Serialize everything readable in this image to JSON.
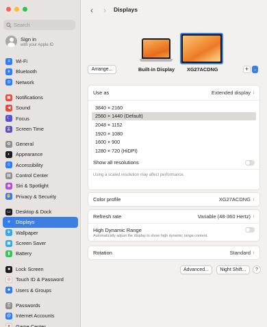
{
  "window": {
    "title": "Displays"
  },
  "sidebar": {
    "search_placeholder": "Search",
    "signin": {
      "title": "Sign in",
      "subtitle": "with your Apple ID"
    },
    "groups": [
      [
        {
          "label": "Wi-Fi",
          "icon": "wifi-icon",
          "color": "#2f7cf6",
          "glyph": "≡"
        },
        {
          "label": "Bluetooth",
          "icon": "bluetooth-icon",
          "color": "#2f7cf6",
          "glyph": "ʙ"
        },
        {
          "label": "Network",
          "icon": "globe-icon",
          "color": "#2f7cf6",
          "glyph": "◎"
        }
      ],
      [
        {
          "label": "Notifications",
          "icon": "bell-icon",
          "color": "#e84a3f",
          "glyph": "▣"
        },
        {
          "label": "Sound",
          "icon": "speaker-icon",
          "color": "#e84a3f",
          "glyph": "◀"
        },
        {
          "label": "Focus",
          "icon": "moon-icon",
          "color": "#5a4fcf",
          "glyph": "☾"
        },
        {
          "label": "Screen Time",
          "icon": "hourglass-icon",
          "color": "#5a4fcf",
          "glyph": "⌛"
        }
      ],
      [
        {
          "label": "General",
          "icon": "gear-icon",
          "color": "#8e8e93",
          "glyph": "⚙"
        },
        {
          "label": "Appearance",
          "icon": "appearance-icon",
          "color": "#1c1c1e",
          "glyph": "◐"
        },
        {
          "label": "Accessibility",
          "icon": "accessibility-icon",
          "color": "#2f7cf6",
          "glyph": "☺"
        },
        {
          "label": "Control Center",
          "icon": "control-center-icon",
          "color": "#8e8e93",
          "glyph": "▤"
        },
        {
          "label": "Siri & Spotlight",
          "icon": "siri-icon",
          "color": "#b04fd6",
          "glyph": "◉"
        },
        {
          "label": "Privacy & Security",
          "icon": "hand-icon",
          "color": "#2f7cf6",
          "glyph": "✋"
        }
      ],
      [
        {
          "label": "Desktop & Dock",
          "icon": "dock-icon",
          "color": "#1c1c1e",
          "glyph": "▭"
        },
        {
          "label": "Displays",
          "icon": "sun-icon",
          "color": "#2f7cf6",
          "glyph": "☀",
          "selected": true
        },
        {
          "label": "Wallpaper",
          "icon": "wallpaper-icon",
          "color": "#33a7e8",
          "glyph": "❄"
        },
        {
          "label": "Screen Saver",
          "icon": "screen-saver-icon",
          "color": "#33a7e8",
          "glyph": "▣"
        },
        {
          "label": "Battery",
          "icon": "battery-icon",
          "color": "#34c759",
          "glyph": "▮"
        }
      ],
      [
        {
          "label": "Lock Screen",
          "icon": "lock-icon",
          "color": "#1c1c1e",
          "glyph": "■"
        },
        {
          "label": "Touch ID & Password",
          "icon": "fingerprint-icon",
          "color": "#f2f1f0",
          "glyph": "◎",
          "dark": true
        },
        {
          "label": "Users & Groups",
          "icon": "users-icon",
          "color": "#2f7cf6",
          "glyph": "☻"
        }
      ],
      [
        {
          "label": "Passwords",
          "icon": "key-icon",
          "color": "#8e8e93",
          "glyph": "⚿"
        },
        {
          "label": "Internet Accounts",
          "icon": "at-icon",
          "color": "#2f7cf6",
          "glyph": "@"
        },
        {
          "label": "Game Center",
          "icon": "game-center-icon",
          "color": "#e8e8ea",
          "glyph": "●",
          "dark": true
        }
      ]
    ]
  },
  "toolbar": {
    "back": "‹",
    "forward": "›"
  },
  "displays": {
    "arrange_label": "Arrange...",
    "builtin_label": "Built-in Display",
    "external_label": "XG27ACDNG",
    "add_label": "+",
    "add_menu": "⌄"
  },
  "settings": {
    "use_as": {
      "label": "Use as",
      "value": "Extended display"
    },
    "resolutions": [
      "3840 × 2160",
      "2560 × 1440 (Default)",
      "2048 × 1152",
      "1920 × 1080",
      "1600 × 900",
      "1280 × 720 (HiDPI)"
    ],
    "selected_resolution_index": 1,
    "show_all": {
      "label": "Show all resolutions",
      "on": false
    },
    "hint": "Using a scaled resolution may affect performance.",
    "color_profile": {
      "label": "Color profile",
      "value": "XG27ACDNG"
    },
    "refresh_rate": {
      "label": "Refresh rate",
      "value": "Variable (48-360 Hertz)"
    },
    "hdr": {
      "label": "High Dynamic Range",
      "sub": "Automatically adjust the display to show high dynamic range content.",
      "on": false
    },
    "rotation": {
      "label": "Rotation",
      "value": "Standard"
    }
  },
  "footer": {
    "advanced": "Advanced...",
    "night_shift": "Night Shift...",
    "help": "?"
  },
  "colors": {
    "accent": "#3d7fe0"
  }
}
